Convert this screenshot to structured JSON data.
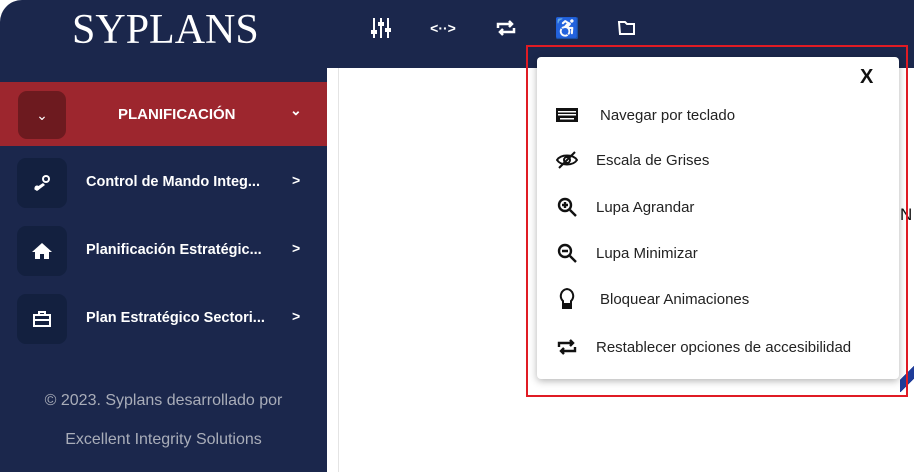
{
  "header": {
    "logo": "SYPLANS",
    "icons": [
      "sliders-icon",
      "arrows-horizontal-icon",
      "repeat-icon",
      "accessibility-icon",
      "folder-open-icon"
    ]
  },
  "sidebar": {
    "active": {
      "label": "PLANIFICACIÓN"
    },
    "items": [
      {
        "label": "Control de Mando Integ...",
        "icon": "steam-icon"
      },
      {
        "label": "Planificación Estratégic...",
        "icon": "home-icon"
      },
      {
        "label": "Plan Estratégico Sectori...",
        "icon": "briefcase-icon"
      }
    ],
    "footer": [
      "© 2023. Syplans desarrollado por",
      "Excellent Integrity Solutions"
    ]
  },
  "accessibility_panel": {
    "close": "X",
    "options": [
      {
        "label": "Navegar por teclado",
        "icon": "keyboard-icon"
      },
      {
        "label": "Escala de Grises",
        "icon": "eye-slash-icon"
      },
      {
        "label": "Lupa Agrandar",
        "icon": "zoom-in-icon"
      },
      {
        "label": "Lupa Minimizar",
        "icon": "zoom-out-icon"
      },
      {
        "label": "Bloquear Animaciones",
        "icon": "lightbulb-icon"
      },
      {
        "label": "Restablecer opciones de accesibilidad",
        "icon": "repeat-icon"
      }
    ]
  },
  "main": {
    "partial_text": "N"
  },
  "colors": {
    "navy": "#1b274c",
    "active": "#9d262e",
    "highlight": "#e01b24"
  }
}
